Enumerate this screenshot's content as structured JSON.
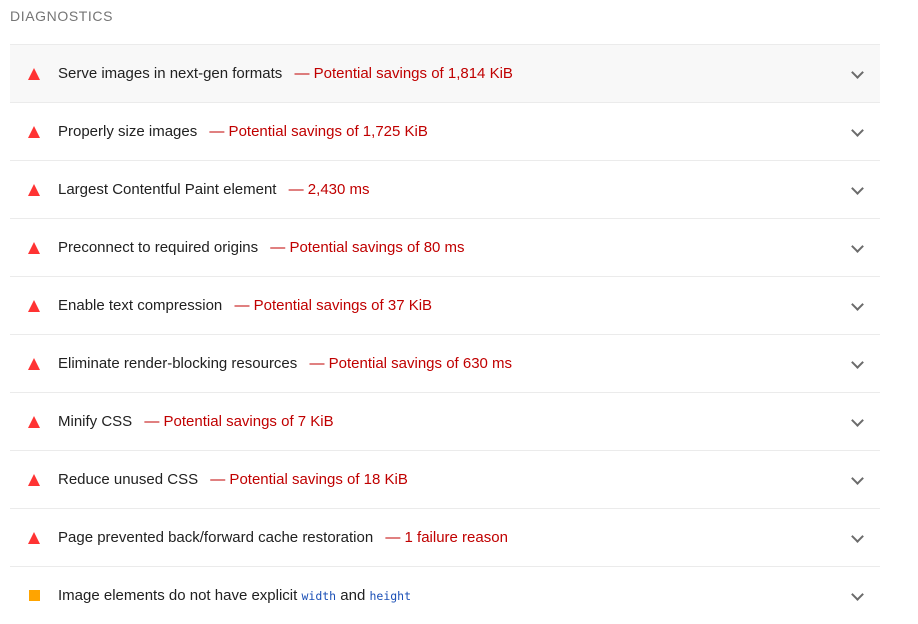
{
  "section": {
    "title": "DIAGNOSTICS"
  },
  "audits": [
    {
      "title": "Serve images in next-gen formats",
      "display": "— Potential savings of 1,814 KiB",
      "status": "fail"
    },
    {
      "title": "Properly size images",
      "display": "— Potential savings of 1,725 KiB",
      "status": "fail"
    },
    {
      "title": "Largest Contentful Paint element",
      "display": "— 2,430 ms",
      "status": "fail"
    },
    {
      "title": "Preconnect to required origins",
      "display": "— Potential savings of 80 ms",
      "status": "fail"
    },
    {
      "title": "Enable text compression",
      "display": "— Potential savings of 37 KiB",
      "status": "fail"
    },
    {
      "title": "Eliminate render-blocking resources",
      "display": "— Potential savings of 630 ms",
      "status": "fail"
    },
    {
      "title": "Minify CSS",
      "display": "— Potential savings of 7 KiB",
      "status": "fail"
    },
    {
      "title": "Reduce unused CSS",
      "display": "— Potential savings of 18 KiB",
      "status": "fail"
    },
    {
      "title": "Page prevented back/forward cache restoration",
      "display": "— 1 failure reason",
      "status": "fail"
    },
    {
      "title_prefix": "Image elements do not have explicit",
      "code_1": "width",
      "conjunction": "and",
      "code_2": "height",
      "status": "average"
    }
  ],
  "icons": {
    "fail": "fail-triangle-icon",
    "average": "average-square-icon",
    "expand": "chevron-down-icon"
  },
  "colors": {
    "fail": "#ff3333",
    "average": "#ffa400",
    "display_text": "#c00000",
    "code": "#1a4fb6"
  }
}
